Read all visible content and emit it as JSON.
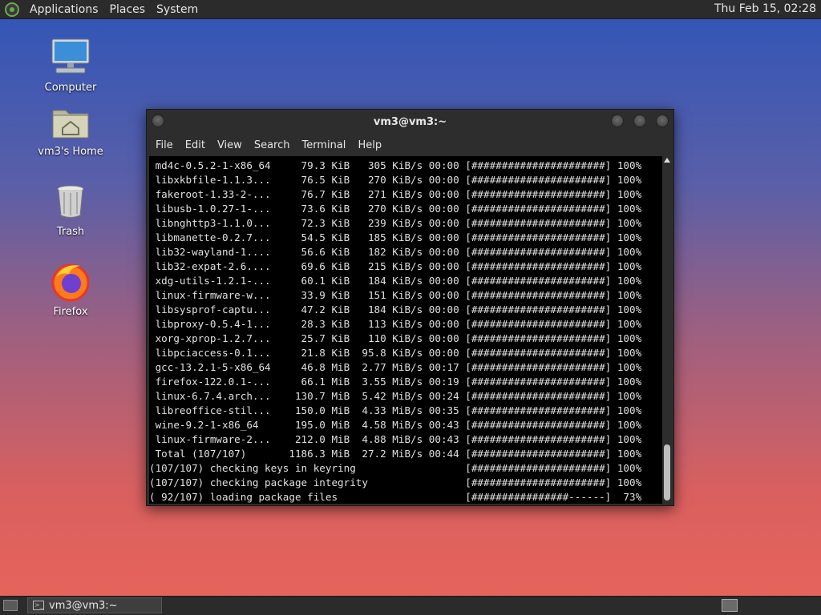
{
  "top_panel": {
    "menus": [
      "Applications",
      "Places",
      "System"
    ],
    "clock": "Thu Feb 15, 02:28"
  },
  "desktop": {
    "icons": [
      {
        "label": "Computer",
        "icon": "computer-icon"
      },
      {
        "label": "vm3's Home",
        "icon": "home-folder-icon"
      },
      {
        "label": "Trash",
        "icon": "trash-icon"
      },
      {
        "label": "Firefox",
        "icon": "firefox-icon"
      }
    ]
  },
  "terminal": {
    "title": "vm3@vm3:~",
    "menus": [
      "File",
      "Edit",
      "View",
      "Search",
      "Terminal",
      "Help"
    ],
    "lines": [
      " md4c-0.5.2-1-x86_64     79.3 KiB   305 KiB/s 00:00 [######################] 100%",
      " libxkbfile-1.1.3...     76.5 KiB   270 KiB/s 00:00 [######################] 100%",
      " fakeroot-1.33-2-...     76.7 KiB   271 KiB/s 00:00 [######################] 100%",
      " libusb-1.0.27-1-...     73.6 KiB   270 KiB/s 00:00 [######################] 100%",
      " libnghttp3-1.1.0...     72.3 KiB   239 KiB/s 00:00 [######################] 100%",
      " libmanette-0.2.7...     54.5 KiB   185 KiB/s 00:00 [######################] 100%",
      " lib32-wayland-1....     56.6 KiB   182 KiB/s 00:00 [######################] 100%",
      " lib32-expat-2.6....     69.6 KiB   215 KiB/s 00:00 [######################] 100%",
      " xdg-utils-1.2.1-...     60.1 KiB   184 KiB/s 00:00 [######################] 100%",
      " linux-firmware-w...     33.9 KiB   151 KiB/s 00:00 [######################] 100%",
      " libsysprof-captu...     47.2 KiB   184 KiB/s 00:00 [######################] 100%",
      " libproxy-0.5.4-1...     28.3 KiB   113 KiB/s 00:00 [######################] 100%",
      " xorg-xprop-1.2.7...     25.7 KiB   110 KiB/s 00:00 [######################] 100%",
      " libpciaccess-0.1...     21.8 KiB  95.8 KiB/s 00:00 [######################] 100%",
      " gcc-13.2.1-5-x86_64     46.8 MiB  2.77 MiB/s 00:17 [######################] 100%",
      " firefox-122.0.1-...     66.1 MiB  3.55 MiB/s 00:19 [######################] 100%",
      " linux-6.7.4.arch...    130.7 MiB  5.42 MiB/s 00:24 [######################] 100%",
      " libreoffice-stil...    150.0 MiB  4.33 MiB/s 00:35 [######################] 100%",
      " wine-9.2-1-x86_64      195.0 MiB  4.58 MiB/s 00:43 [######################] 100%",
      " linux-firmware-2...    212.0 MiB  4.88 MiB/s 00:43 [######################] 100%",
      " Total (107/107)       1186.3 MiB  27.2 MiB/s 00:44 [######################] 100%",
      "(107/107) checking keys in keyring                  [######################] 100%",
      "(107/107) checking package integrity                [######################] 100%",
      "( 92/107) loading package files                     [################------]  73%"
    ]
  },
  "taskbar": {
    "task_label": "vm3@vm3:~"
  }
}
